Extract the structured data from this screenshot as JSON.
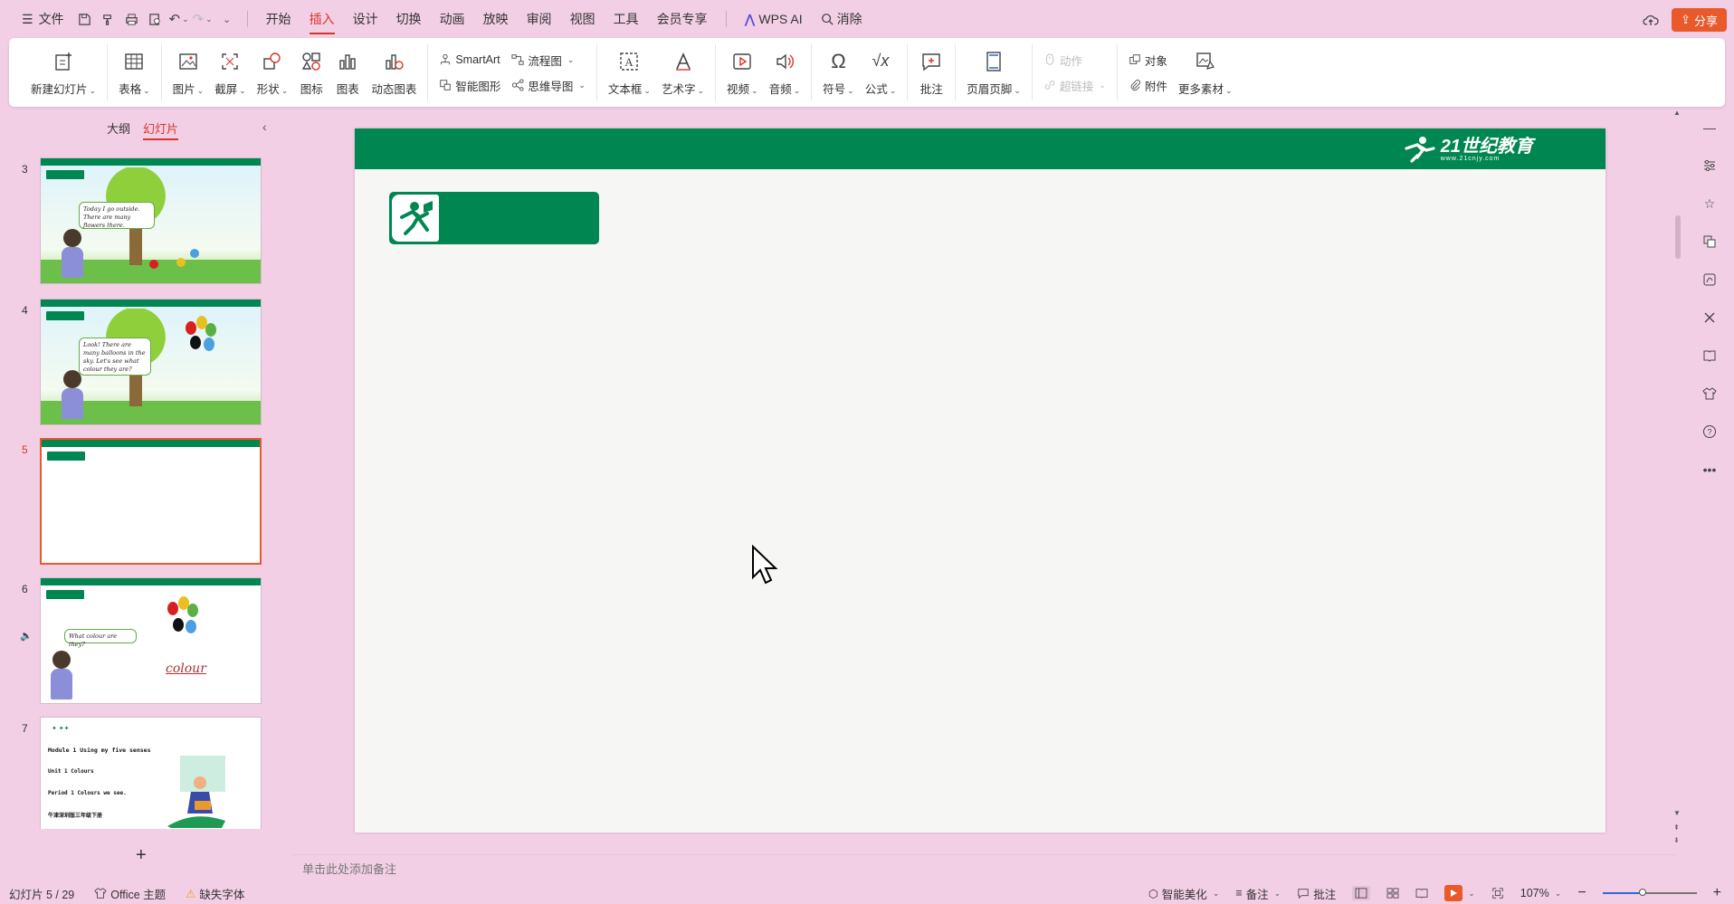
{
  "menubar": {
    "file_label": "文件",
    "tabs": [
      "开始",
      "插入",
      "设计",
      "切换",
      "动画",
      "放映",
      "审阅",
      "视图",
      "工具",
      "会员专享"
    ],
    "active_tab": "插入",
    "wps_ai": "WPS AI",
    "search": "消除",
    "share": "分享"
  },
  "ribbon": {
    "new_slide": "新建幻灯片",
    "table": "表格",
    "picture": "图片",
    "screenshot": "截屏",
    "shape": "形状",
    "icon": "图标",
    "chart": "图表",
    "dynamic_chart": "动态图表",
    "smartart": "SmartArt",
    "smart_graphic": "智能图形",
    "flowchart": "流程图",
    "mindmap": "思维导图",
    "textbox": "文本框",
    "wordart": "艺术字",
    "video": "视频",
    "audio": "音频",
    "symbol": "符号",
    "formula": "公式",
    "comment": "批注",
    "header_footer": "页眉页脚",
    "action": "动作",
    "hyperlink": "超链接",
    "object": "对象",
    "attachment": "附件",
    "more_material": "更多素材"
  },
  "left_panel": {
    "tab_outline": "大纲",
    "tab_slides": "幻灯片",
    "slides": [
      {
        "num": "3",
        "bubble": "Today I go outside. There are many flowers there."
      },
      {
        "num": "4",
        "bubble": "Look! There are many balloons in the sky. Let's see what colour they are?"
      },
      {
        "num": "5"
      },
      {
        "num": "6",
        "bubble": "What colour are they?",
        "word": "colour"
      },
      {
        "num": "7",
        "lines": [
          "Module 1 Using my five senses",
          "Unit 1 Colours",
          "Period 1 Colours we see.",
          "牛津深圳版三年级下册"
        ]
      }
    ],
    "active_slide": "5"
  },
  "slide": {
    "brand_name": "21世纪教育",
    "brand_url": "www.21cnjy.com",
    "header_color": "#008751"
  },
  "notes_placeholder": "单击此处添加备注",
  "statusbar": {
    "slide_counter": "幻灯片 5 / 29",
    "theme": "Office 主题",
    "missing_font": "缺失字体",
    "smart_beautify": "智能美化",
    "notes": "备注",
    "comments": "批注",
    "zoom": "107%",
    "zoom_level": 0.43
  },
  "colors": {
    "accent": "#d9342b",
    "share": "#e9592a",
    "brand_green": "#008751"
  }
}
